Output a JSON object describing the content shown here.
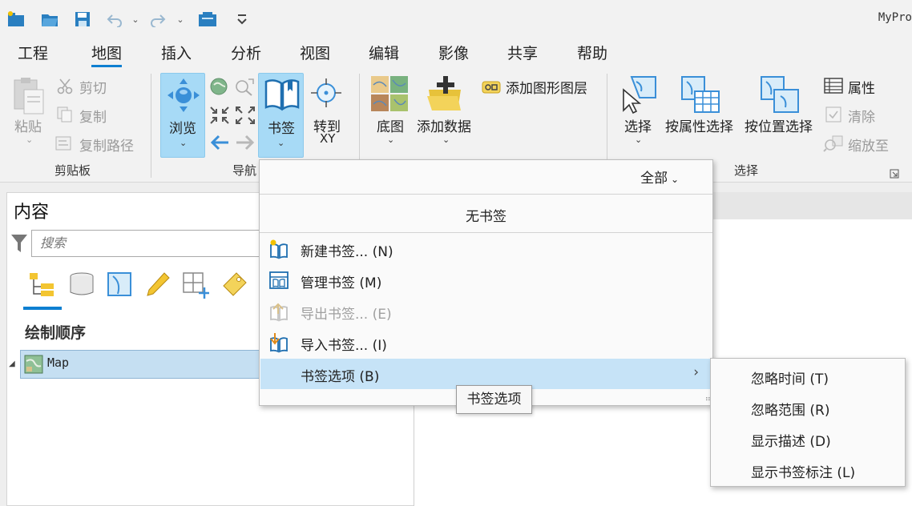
{
  "app": {
    "title": "MyPro"
  },
  "tabs": [
    {
      "label": "工程"
    },
    {
      "label": "地图"
    },
    {
      "label": "插入"
    },
    {
      "label": "分析"
    },
    {
      "label": "视图"
    },
    {
      "label": "编辑"
    },
    {
      "label": "影像"
    },
    {
      "label": "共享"
    },
    {
      "label": "帮助"
    }
  ],
  "ribbon": {
    "clipboard": {
      "paste": "粘贴",
      "cut": "剪切",
      "copy": "复制",
      "copy_path": "复制路径",
      "group": "剪贴板"
    },
    "navigate": {
      "explore": "浏览",
      "bookmarks": "书签",
      "goto_xy_line1": "转到",
      "goto_xy_line2": "XY",
      "group": "导航"
    },
    "layer": {
      "basemap": "底图",
      "add_data": "添加数据",
      "add_graphics_layer": "添加图形图层"
    },
    "selection": {
      "select": "选择",
      "select_by_attributes": "按属性选择",
      "select_by_location": "按位置选择",
      "attributes": "属性",
      "clear": "清除",
      "zoom_to": "缩放至",
      "group": "选择"
    }
  },
  "contents": {
    "title": "内容",
    "search_placeholder": "搜索",
    "drawing_order": "绘制顺序",
    "map_item": "Map"
  },
  "bookmarks_menu": {
    "filter": "全部",
    "empty": "无书签",
    "items": [
      {
        "label": "新建书签... (N)",
        "enabled": true
      },
      {
        "label": "管理书签 (M)",
        "enabled": true
      },
      {
        "label": "导出书签... (E)",
        "enabled": false
      },
      {
        "label": "导入书签... (I)",
        "enabled": true
      },
      {
        "label": "书签选项 (B)",
        "enabled": true
      }
    ]
  },
  "tooltip": "书签选项",
  "submenu": {
    "items": [
      {
        "label": "忽略时间 (T)"
      },
      {
        "label": "忽略范围 (R)"
      },
      {
        "label": "显示描述 (D)"
      },
      {
        "label": "显示书签标注 (L)"
      }
    ]
  },
  "colors": {
    "accent": "#0e7fd1",
    "selected_button": "#a7daf6",
    "menu_highlight": "#c6e3f7",
    "tree_selection": "#c5dff2"
  }
}
